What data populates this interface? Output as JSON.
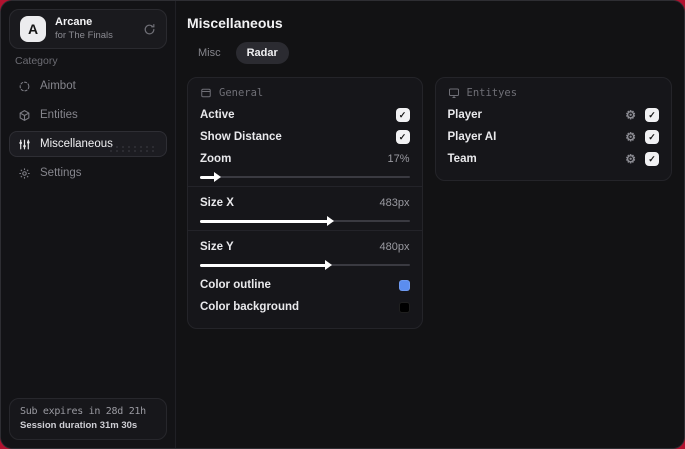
{
  "theme": {
    "desktop_red": "#b2122f",
    "accent_blue": "#5b8def"
  },
  "icons": {
    "check": "✓",
    "gear": "⚙"
  },
  "sidebar": {
    "app": {
      "logo_letter": "A",
      "title": "Arcane",
      "subtitle": "for The Finals"
    },
    "category_label": "Category",
    "items": [
      {
        "label": "Aimbot"
      },
      {
        "label": "Entities"
      },
      {
        "label": "Miscellaneous"
      },
      {
        "label": "Settings"
      }
    ],
    "subscription": {
      "line1": "Sub expires in 28d 21h",
      "line2": "Session duration 31m 30s"
    }
  },
  "main": {
    "title": "Miscellaneous",
    "tabs": [
      {
        "label": "Misc"
      },
      {
        "label": "Radar"
      }
    ],
    "general": {
      "title": "General",
      "toggles": [
        {
          "label": "Active",
          "checked": true
        },
        {
          "label": "Show Distance",
          "checked": true
        }
      ],
      "sliders": [
        {
          "label": "Zoom",
          "value": "17%",
          "fraction": 0.07
        },
        {
          "label": "Size X",
          "value": "483px",
          "fraction": 0.61
        },
        {
          "label": "Size Y",
          "value": "480px",
          "fraction": 0.6
        }
      ],
      "colors": [
        {
          "label": "Color outline",
          "swatch": "#5b8def"
        },
        {
          "label": "Color background",
          "swatch": "#000000"
        }
      ]
    },
    "entities": {
      "title": "Entityes",
      "rows": [
        {
          "label": "Player",
          "checked": true
        },
        {
          "label": "Player AI",
          "checked": true
        },
        {
          "label": "Team",
          "checked": true
        }
      ]
    }
  }
}
